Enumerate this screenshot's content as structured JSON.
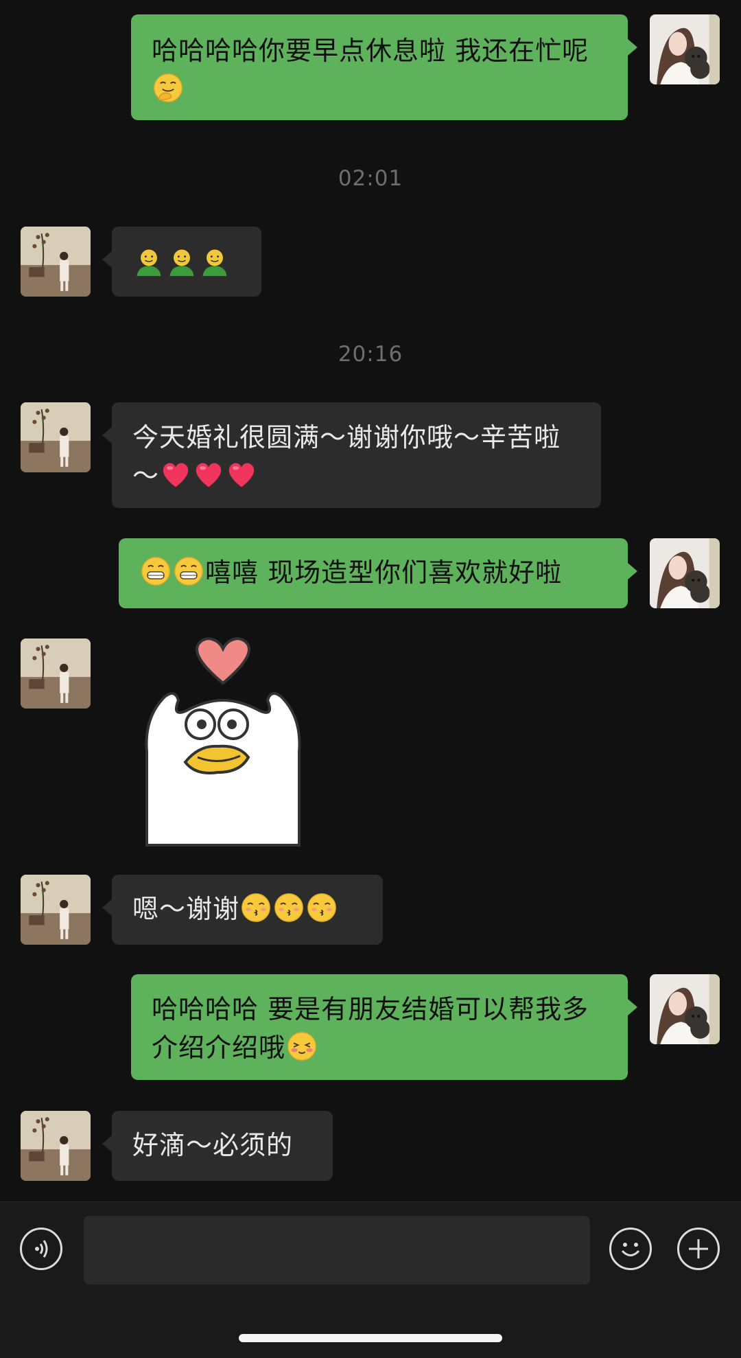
{
  "messages": [
    {
      "sender": "me",
      "text": "哈哈哈哈你要早点休息啦 我还在忙呢",
      "emoji": [
        "smirk-hand-emoji"
      ]
    },
    {
      "timestamp": "02:01"
    },
    {
      "sender": "them",
      "emoji": [
        "grinning-person-emoji",
        "grinning-person-emoji",
        "grinning-person-emoji"
      ]
    },
    {
      "timestamp": "20:16"
    },
    {
      "sender": "them",
      "text": "今天婚礼很圆满～谢谢你哦～辛苦啦～",
      "emoji": [
        "heart-emoji",
        "heart-emoji",
        "heart-emoji"
      ]
    },
    {
      "sender": "me",
      "text_before": "",
      "text": "嘻嘻 现场造型你们喜欢就好啦",
      "emoji": [
        "grin-emoji",
        "grin-emoji"
      ]
    },
    {
      "sender": "them",
      "sticker": "duck-heart-sticker"
    },
    {
      "sender": "them",
      "text": "嗯～谢谢",
      "emoji": [
        "kiss-emoji",
        "kiss-emoji",
        "kiss-emoji"
      ]
    },
    {
      "sender": "me",
      "text": "哈哈哈哈 要是有朋友结婚可以帮我多介绍介绍哦",
      "emoji": [
        "shy-emoji"
      ]
    },
    {
      "sender": "them",
      "text": "好滴～必须的"
    }
  ],
  "timestamps": {
    "t1": "02:01",
    "t2": "20:16"
  },
  "texts": {
    "m1": "哈哈哈哈你要早点休息啦 我还在忙呢",
    "m5": "今天婚礼很圆满～谢谢你哦～辛苦啦～",
    "m6": "嘻嘻 现场造型你们喜欢就好啦",
    "m8": "嗯～谢谢",
    "m9": "哈哈哈哈 要是有朋友结婚可以帮我多介绍介绍哦",
    "m10": "好滴～必须的"
  },
  "input_bar": {
    "voice_icon": "voice-icon",
    "emoji_icon": "emoji-icon",
    "plus_icon": "plus-icon",
    "input_value": ""
  },
  "colors": {
    "background": "#111111",
    "my_bubble": "#5fb25c",
    "their_bubble": "#2c2c2c",
    "timestamp": "#6e6e6e"
  }
}
